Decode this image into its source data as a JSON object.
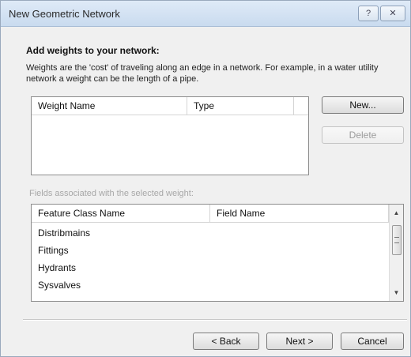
{
  "window": {
    "title": "New Geometric Network",
    "help_glyph": "?",
    "close_glyph": "✕"
  },
  "page": {
    "heading": "Add weights to your network:",
    "description": "Weights are the 'cost' of traveling along an edge in a network. For example, in a water utility network a weight can be the length of a pipe."
  },
  "weights_list": {
    "columns": [
      "Weight Name",
      "Type"
    ],
    "rows": []
  },
  "buttons": {
    "new": "New...",
    "delete": "Delete",
    "back": "< Back",
    "next": "Next >",
    "cancel": "Cancel"
  },
  "fields": {
    "label": "Fields associated with the selected weight:",
    "columns": [
      "Feature Class Name",
      "Field Name"
    ],
    "rows": [
      "Distribmains",
      "Fittings",
      "Hydrants",
      "Sysvalves"
    ]
  },
  "scrollbar": {
    "up_glyph": "▲",
    "down_glyph": "▼"
  }
}
